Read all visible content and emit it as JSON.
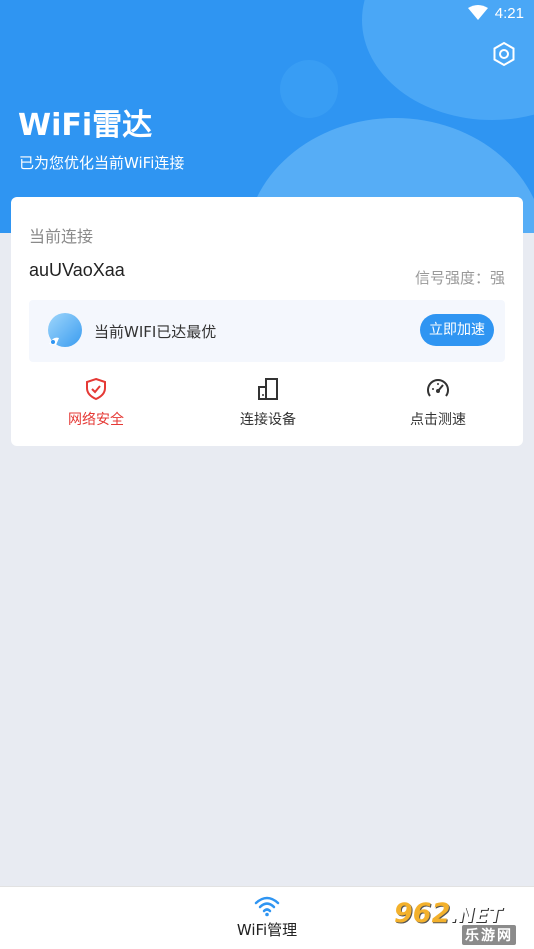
{
  "status_bar": {
    "time": "4:21"
  },
  "header": {
    "title": "WiFi雷达",
    "subtitle": "已为您优化当前WiFi连接"
  },
  "card": {
    "section_label": "当前连接",
    "ssid": "auUVaoXaa",
    "signal": "信号强度：强",
    "optimization": {
      "text": "当前WIFI已达最优",
      "button": "立即加速"
    },
    "actions": [
      {
        "label": "网络安全",
        "icon": "shield-check-icon",
        "active": true
      },
      {
        "label": "连接设备",
        "icon": "devices-icon",
        "active": false
      },
      {
        "label": "点击测速",
        "icon": "speedometer-icon",
        "active": false
      }
    ]
  },
  "bottom_nav": {
    "items": [
      {
        "label": "WiFi管理",
        "icon": "wifi-icon"
      }
    ]
  },
  "watermark": {
    "top": "962",
    "net": ".NET",
    "bottom": "乐游网"
  },
  "colors": {
    "primary": "#2f95f2",
    "active_red": "#e53935",
    "background": "#e8ebf2"
  }
}
